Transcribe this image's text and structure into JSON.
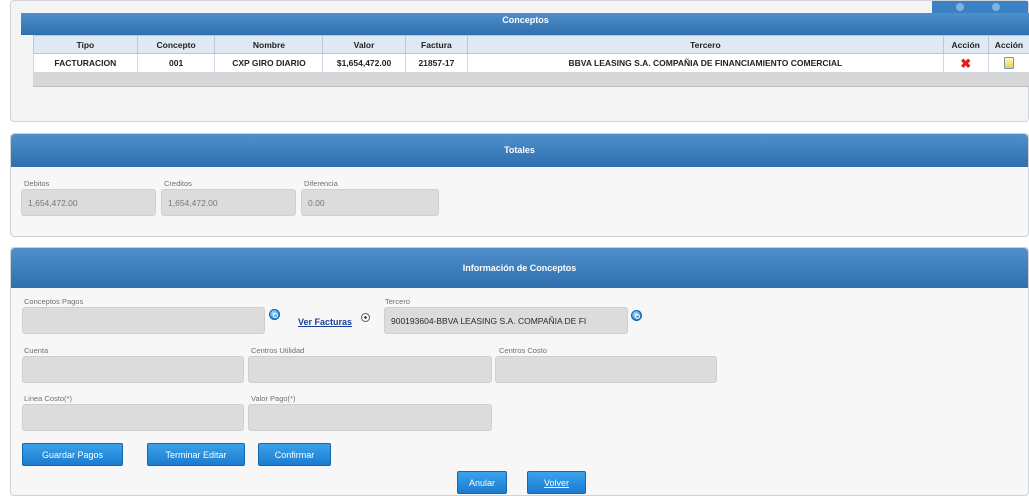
{
  "conceptos": {
    "title": "Conceptos",
    "columns": [
      "Tipo",
      "Concepto",
      "Nombre",
      "Valor",
      "Factura",
      "Tercero",
      "Acción",
      "Acción"
    ],
    "rows": [
      {
        "tipo": "FACTURACION",
        "concepto": "001",
        "nombre": "CXP GIRO DIARIO",
        "valor": "$1,654,472.00",
        "factura": "21857-17",
        "tercero": "BBVA LEASING S.A. COMPAÑIA DE FINANCIAMIENTO COMERCIAL",
        "accion1_icon": "delete-x-icon",
        "accion2_icon": "edit-document-icon"
      }
    ]
  },
  "totales": {
    "title": "Totales",
    "debitos_label": "Debitos",
    "debitos_value": "1,654,472.00",
    "creditos_label": "Creditos",
    "creditos_value": "1,654,472.00",
    "diferencia_label": "Diferencia",
    "diferencia_value": "0.00"
  },
  "info": {
    "title": "Información de Conceptos",
    "conceptos_pagos_label": "Conceptos Pagos",
    "conceptos_pagos_value": "",
    "ver_facturas": "Ver Facturas",
    "tercero_label": "Tercero",
    "tercero_value": "900193604-BBVA LEASING S.A. COMPAÑIA DE FI",
    "cuenta_label": "Cuenta",
    "centros_utilidad_label": "Centros Utilidad",
    "centros_costo_label": "Centros Costo",
    "linea_costo_label": "Linea Costo(*)",
    "valor_pago_label": "Valor Pago(*)"
  },
  "buttons": {
    "guardar_pagos": "Guardar Pagos",
    "terminar_editar": "Terminar Editar",
    "confirmar": "Confirmar",
    "anular": "Anular",
    "volver": "Volver"
  },
  "colors": {
    "header_blue": "#2f6fae",
    "button_blue": "#1b7bd0",
    "delete_red": "#e21f1f"
  }
}
